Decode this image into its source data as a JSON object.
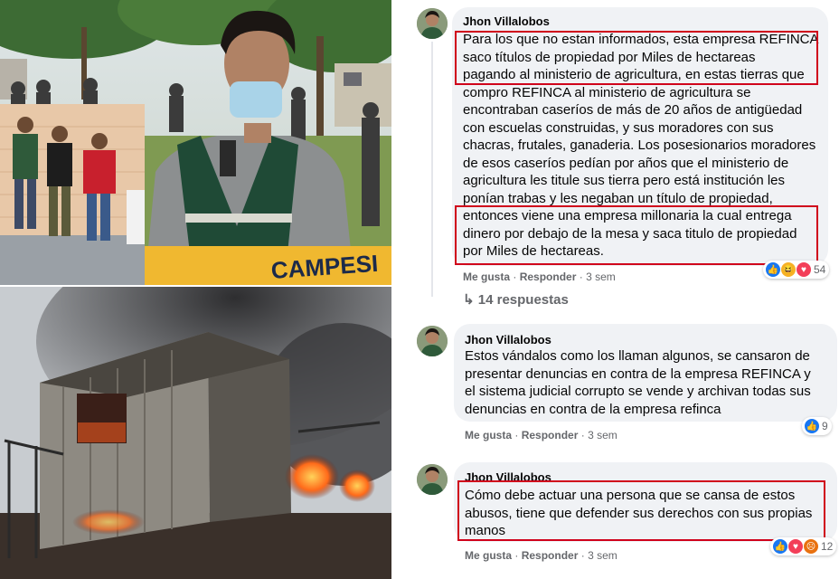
{
  "photos": {
    "top_left": {
      "banner_text": "CAMPESI"
    },
    "bottom_left": {}
  },
  "comments": [
    {
      "author": "Jhon Villalobos",
      "text": "Para los que no estan informados, esta empresa REFINCA\nsaco títulos de propiedad por Miles de hectareas\npagando al ministerio de agricultura, en estas tierras que\ncompro REFINCA al ministerio de agricultura se\nencontraban caseríos de más de 20 años de antigüedad\ncon escuelas construidas, y sus moradores con sus\nchacras, frutales, ganaderia. Los posesionarios moradores\nde esos caseríos pedían por años que el ministerio de\nagricultura les titule sus tierra pero está institución les\nponían trabas y les negaban un título de propiedad,\nentonces viene una empresa millonaria la cual entrega\ndinero por debajo de la mesa y saca titulo de propiedad\npor Miles de hectareas.",
      "like": "Me gusta",
      "reply": "Responder",
      "time": "3 sem",
      "reaction_count": "54",
      "reactions": [
        "like-icon",
        "haha-icon",
        "love-icon"
      ],
      "replies_label": "14 respuestas"
    },
    {
      "author": "Jhon Villalobos",
      "text": "Estos vándalos como los llaman algunos, se cansaron de\npresentar denuncias en contra de la empresa REFINCA y\nel sistema judicial corrupto se vende y archivan todas sus\ndenuncias en contra de la empresa refinca",
      "like": "Me gusta",
      "reply": "Responder",
      "time": "3 sem",
      "reaction_count": "9",
      "reactions": [
        "like-icon"
      ]
    },
    {
      "author": "Jhon Villalobos",
      "text": "Cómo debe actuar una persona que se cansa de estos\nabusos, tiene que defender sus derechos con sus propias\nmanos",
      "like": "Me gusta",
      "reply": "Responder",
      "time": "3 sem",
      "reaction_count": "12",
      "reactions": [
        "like-icon",
        "love-icon",
        "angry-icon"
      ]
    }
  ],
  "separator": "·",
  "colors": {
    "highlight": "#d0021b",
    "bubble": "#f0f2f5",
    "like_blue": "#1877f2",
    "love_red": "#f33e58",
    "haha_yellow": "#f7b125",
    "angry_orange": "#e9710f"
  }
}
